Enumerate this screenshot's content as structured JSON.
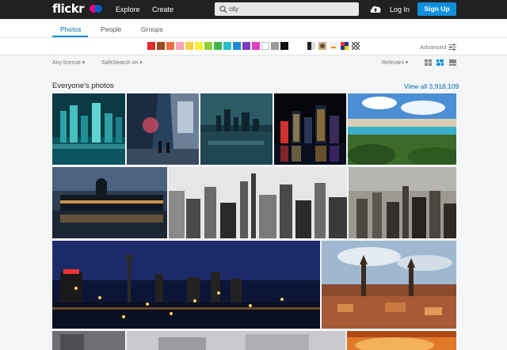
{
  "header": {
    "logo": "flickr",
    "nav": {
      "explore": "Explore",
      "create": "Create"
    },
    "search": {
      "value": "city",
      "placeholder": ""
    },
    "login": "Log In",
    "signup": "Sign Up"
  },
  "tabs": [
    {
      "label": "Photos"
    },
    {
      "label": "People"
    },
    {
      "label": "Groups"
    }
  ],
  "color_swatches": [
    "#e32a2a",
    "#9c4a1f",
    "#f26a3a",
    "#f7a3b7",
    "#f6d245",
    "#f4ef3a",
    "#8fd03a",
    "#3db54a",
    "#2bbfc7",
    "#1f8bd6",
    "#7a3bbd",
    "#e03fbf",
    "#ffffff",
    "#9a9a9a",
    "#111111"
  ],
  "advanced": "Advanced",
  "options": {
    "license": "Any license",
    "safesearch": "SafeSearch on",
    "sort": "Relevant"
  },
  "section": {
    "title": "Everyone's photos",
    "view_all": "View all 3,918,109"
  }
}
